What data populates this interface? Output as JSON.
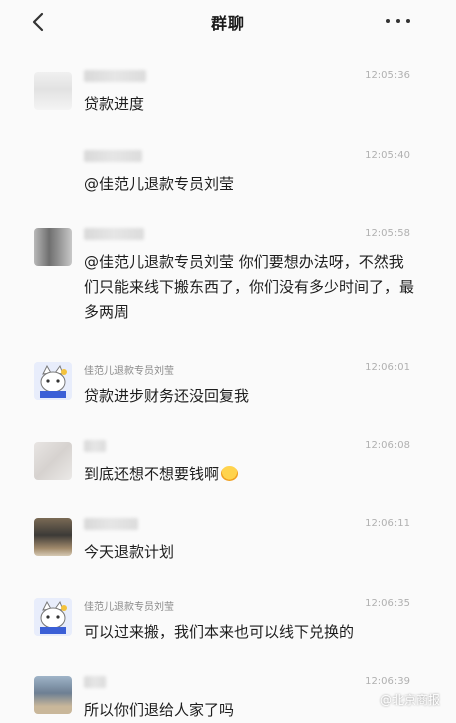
{
  "header": {
    "title": "群聊"
  },
  "messages": [
    {
      "name": "",
      "time": "12:05:36",
      "text": "贷款进度"
    },
    {
      "name": "",
      "time": "12:05:40",
      "text": "@佳范儿退款专员刘莹"
    },
    {
      "name": "",
      "time": "12:05:58",
      "text": "@佳范儿退款专员刘莹 你们要想办法呀，不然我们只能来线下搬东西了，你们没有多少时间了，最多两周"
    },
    {
      "name": "佳范儿退款专员刘莹",
      "time": "12:06:01",
      "text": "贷款进步财务还没回复我"
    },
    {
      "name": "",
      "time": "12:06:08",
      "text": "到底还想不想要钱啊"
    },
    {
      "name": "",
      "time": "12:06:11",
      "text": "今天退款计划"
    },
    {
      "name": "佳范儿退款专员刘莹",
      "time": "12:06:35",
      "text": "可以过来搬，我们本来也可以线下兑换的"
    },
    {
      "name": "",
      "time": "12:06:39",
      "text": "所以你们退给人家了吗"
    }
  ],
  "watermark": "@北京商报",
  "colors": {
    "background": "#fafafa",
    "text": "#1d1d1d",
    "time": "#b0b0b0"
  }
}
